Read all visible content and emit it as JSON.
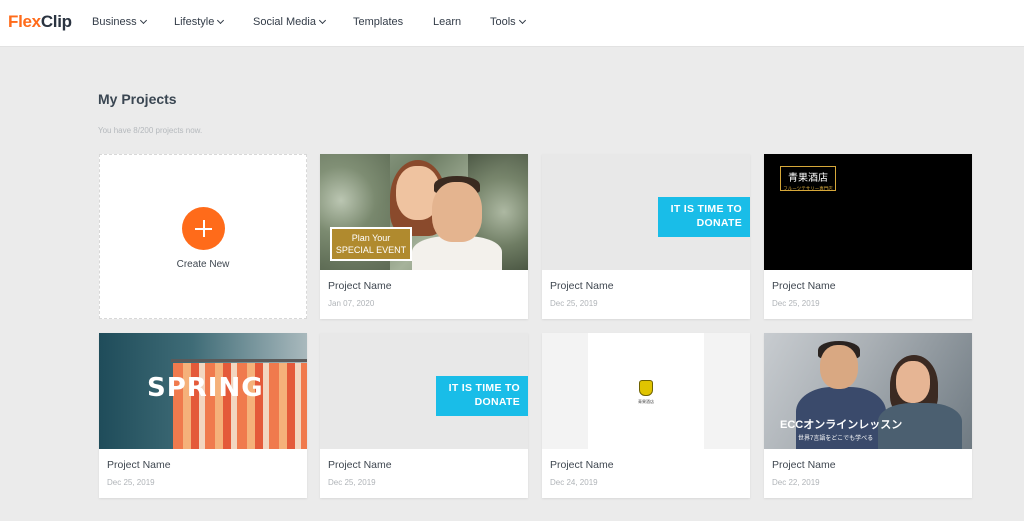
{
  "brand": {
    "name_part1": "Flex",
    "name_part2": "Clip",
    "accent_color": "#ff6b1a"
  },
  "nav": {
    "items": [
      {
        "label": "Business",
        "has_dropdown": true
      },
      {
        "label": "Lifestyle",
        "has_dropdown": true
      },
      {
        "label": "Social Media",
        "has_dropdown": true
      },
      {
        "label": "Templates",
        "has_dropdown": false
      },
      {
        "label": "Learn",
        "has_dropdown": false
      },
      {
        "label": "Tools",
        "has_dropdown": true
      }
    ]
  },
  "page": {
    "title": "My Projects",
    "subtitle": "You have 8/200 projects now."
  },
  "create_card": {
    "label": "Create New",
    "icon": "plus-icon"
  },
  "projects": [
    {
      "name": "Project Name",
      "date": "Jan 07, 2020",
      "thumb_text_1": "Plan Your",
      "thumb_text_2": "SPECIAL EVENT"
    },
    {
      "name": "Project Name",
      "date": "Dec 25, 2019",
      "thumb_text_1": "IT IS TIME TO",
      "thumb_text_2": "DONATE"
    },
    {
      "name": "Project Name",
      "date": "Dec 25, 2019",
      "thumb_text_1": "青果酒店",
      "thumb_text_2": "フルーツテサリー専門店"
    },
    {
      "name": "Project Name",
      "date": "Dec 25, 2019",
      "thumb_text_1": "SPRING"
    },
    {
      "name": "Project Name",
      "date": "Dec 25, 2019",
      "thumb_text_1": "IT IS TIME TO",
      "thumb_text_2": "DONATE"
    },
    {
      "name": "Project Name",
      "date": "Dec 24, 2019",
      "thumb_text_1": "青果酒店"
    },
    {
      "name": "Project Name",
      "date": "Dec 22, 2019",
      "thumb_text_1": "ECCオンラインレッスン",
      "thumb_text_2": "世界7言語をどこでも学べる"
    }
  ]
}
